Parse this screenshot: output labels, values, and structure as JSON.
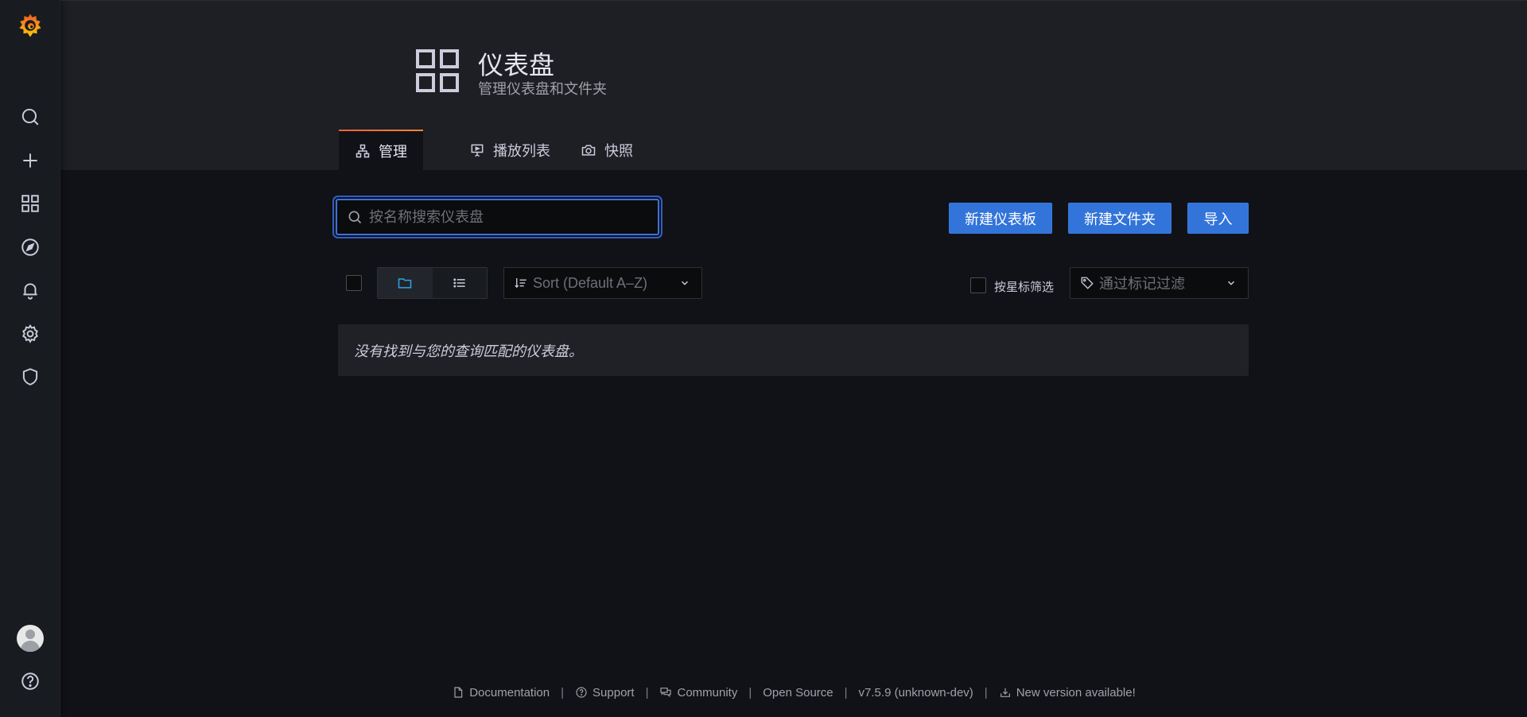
{
  "header": {
    "title": "仪表盘",
    "subtitle": "管理仪表盘和文件夹",
    "tabs": [
      {
        "label": "管理",
        "icon": "sitemap-icon"
      },
      {
        "label": "播放列表",
        "icon": "presentation-icon"
      },
      {
        "label": "快照",
        "icon": "camera-icon"
      }
    ]
  },
  "search": {
    "placeholder": "按名称搜索仪表盘",
    "value": ""
  },
  "actions": {
    "new_dashboard": "新建仪表板",
    "new_folder": "新建文件夹",
    "import": "导入"
  },
  "filters": {
    "sort_label": "Sort (Default A–Z)",
    "starred_label": "按星标筛选",
    "tag_placeholder": "通过标记过滤"
  },
  "results": {
    "empty_message": "没有找到与您的查询匹配的仪表盘。"
  },
  "footer": {
    "links": [
      "Documentation",
      "Support",
      "Community",
      "Open Source"
    ],
    "version": "v7.5.9 (unknown-dev)",
    "update": "New version available!"
  },
  "colors": {
    "accent_blue": "#3274d9",
    "tab_highlight": "#f55f3e",
    "background": "#111217",
    "panel": "#1f2126"
  }
}
